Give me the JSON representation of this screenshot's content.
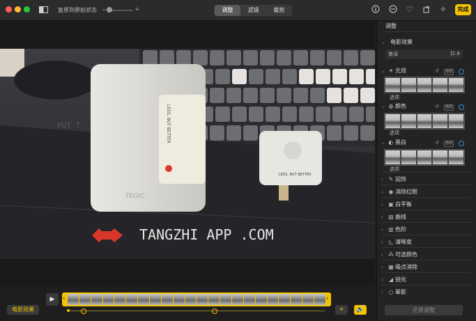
{
  "toolbar": {
    "revert_label": "复原到原始状态",
    "tabs": [
      {
        "label": "调整",
        "active": true
      },
      {
        "label": "滤镜",
        "active": false
      },
      {
        "label": "裁剪",
        "active": false
      }
    ],
    "done_label": "完成"
  },
  "photo": {
    "watermark_text": "TANGZHI APP .COM",
    "device_text_1": "LESS, BUT BETTER",
    "device_text_2": "LESS, BUT BETTER",
    "device_brand": "TEGIC",
    "mat_text": "PUT T"
  },
  "bottom": {
    "cinematic_label": "电影效果"
  },
  "sidebar": {
    "header": "调整",
    "cinematic": {
      "label": "电影效果",
      "depth_label": "景深",
      "aperture": "ƒ2.8"
    },
    "sections": [
      {
        "label": "光效",
        "badge": "自动",
        "options": "选项"
      },
      {
        "label": "颜色",
        "badge": "自动",
        "options": "选项"
      },
      {
        "label": "黑白",
        "badge": "自动",
        "options": "选项"
      }
    ],
    "tools": [
      {
        "label": "润饰",
        "icon": "retouch-icon"
      },
      {
        "label": "消除红眼",
        "icon": "red-eye-icon"
      },
      {
        "label": "白平衡",
        "icon": "white-balance-icon"
      },
      {
        "label": "曲线",
        "icon": "curves-icon"
      },
      {
        "label": "色阶",
        "icon": "levels-icon"
      },
      {
        "label": "清晰度",
        "icon": "definition-icon"
      },
      {
        "label": "可选颜色",
        "icon": "selective-color-icon"
      },
      {
        "label": "噪点消除",
        "icon": "noise-reduction-icon"
      },
      {
        "label": "锐化",
        "icon": "sharpen-icon"
      },
      {
        "label": "晕影",
        "icon": "vignette-icon"
      }
    ],
    "reset_label": "还原调整"
  },
  "colors": {
    "accent_yellow": "#f5c400",
    "accent_blue": "#3a8dde",
    "close": "#ff5f57",
    "minimize": "#febc2e",
    "zoom": "#28c840"
  }
}
